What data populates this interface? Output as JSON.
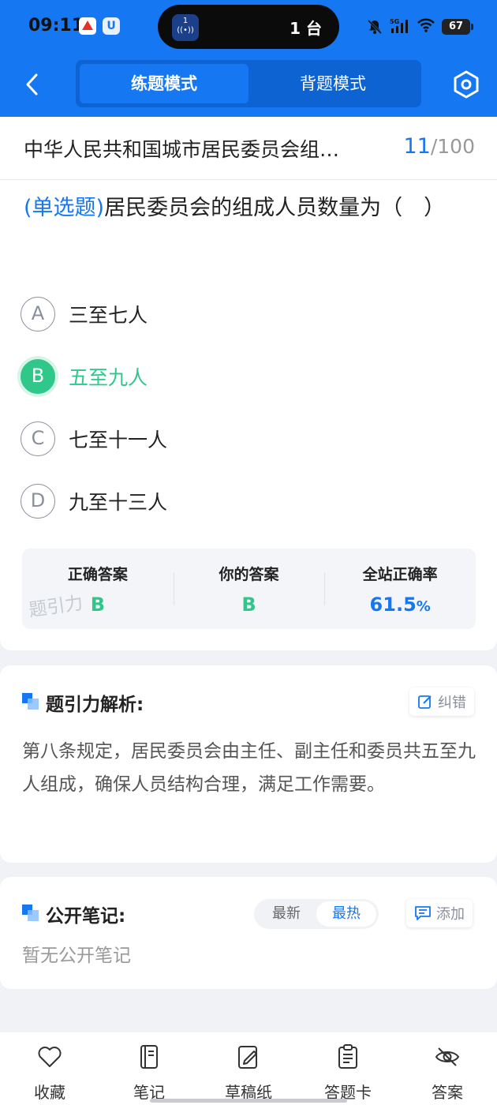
{
  "status_bar": {
    "time": "09:11",
    "island_badge": "1",
    "island_text": "1 台",
    "network": "5G",
    "battery": "67"
  },
  "header": {
    "tabs": [
      {
        "label": "练题模式",
        "active": true
      },
      {
        "label": "背题模式",
        "active": false
      }
    ]
  },
  "question_meta": {
    "doc_title": "中华人民共和国城市居民委员会组…",
    "current": "11",
    "separator": "/",
    "total": "100"
  },
  "question": {
    "type": "(单选题)",
    "text": "居民委员会的组成人员数量为（　）",
    "options": [
      {
        "letter": "A",
        "text": "三至七人"
      },
      {
        "letter": "B",
        "text": "五至九人",
        "correct": true
      },
      {
        "letter": "C",
        "text": "七至十一人"
      },
      {
        "letter": "D",
        "text": "九至十三人"
      }
    ]
  },
  "answer_summary": {
    "correct_label": "正确答案",
    "correct_value": "B",
    "yours_label": "你的答案",
    "yours_value": "B",
    "rate_label": "全站正确率",
    "rate_value": "61.5",
    "rate_unit": "%",
    "watermark": "题引力"
  },
  "analysis": {
    "title": "题引力解析:",
    "correct_error_label": "纠错",
    "text": "第八条规定，居民委员会由主任、副主任和委员共五至九人组成，确保人员结构合理，满足工作需要。"
  },
  "notes": {
    "title": "公开笔记:",
    "sort_options": [
      "最新",
      "最热"
    ],
    "active_sort": "最热",
    "add_label": "添加",
    "empty_text": "暂无公开笔记"
  },
  "bottom_nav": [
    {
      "label": "收藏",
      "icon": "heart-icon"
    },
    {
      "label": "笔记",
      "icon": "notebook-icon"
    },
    {
      "label": "草稿纸",
      "icon": "draft-icon"
    },
    {
      "label": "答题卡",
      "icon": "clipboard-icon"
    },
    {
      "label": "答案",
      "icon": "eye-off-icon"
    }
  ],
  "colors": {
    "primary": "#1677f2",
    "correct": "#2fc78a",
    "muted": "#8a8f9d"
  }
}
